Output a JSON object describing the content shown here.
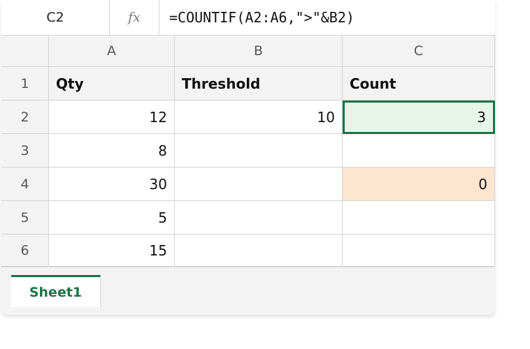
{
  "formula_bar": {
    "cell_ref": "C2",
    "fx_label": "fx",
    "formula": "=COUNTIF(A2:A6,\">\"&B2)"
  },
  "columns": [
    "A",
    "B",
    "C"
  ],
  "rows": [
    "1",
    "2",
    "3",
    "4",
    "5",
    "6"
  ],
  "cells": {
    "A1": "Qty",
    "B1": "Threshold",
    "C1": "Count",
    "A2": "12",
    "B2": "10",
    "C2": "3",
    "A3": "8",
    "B3": "",
    "C3": "",
    "A4": "30",
    "B4": "",
    "C4": "0",
    "A5": "5",
    "B5": "",
    "C5": "",
    "A6": "15",
    "B6": "",
    "C6": ""
  },
  "selected_cell": "C2",
  "highlight_colors": {
    "selected_fill": "#e8f4ea",
    "selected_border": "#1e7145",
    "warning_fill": "#fde5d0"
  },
  "sheet_tabs": [
    {
      "label": "Sheet1",
      "active": true
    }
  ]
}
